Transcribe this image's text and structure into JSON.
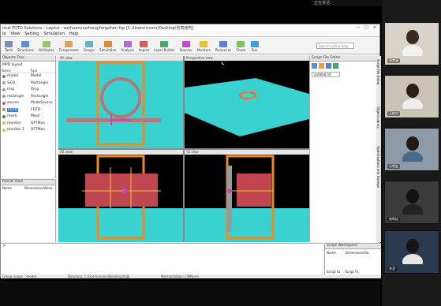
{
  "window": {
    "title": "rical FDTD Solutions - Layout - weihuanxiuzhong/fangzhen.fsp [C:/Users/vivers/Desktop/仿真结构]",
    "controls": [
      "—",
      "□",
      "✕"
    ]
  },
  "menu": [
    "le",
    "View",
    "Setting",
    "Simulation",
    "Help"
  ],
  "toolbar": {
    "items": [
      "Tools",
      "Structures",
      "Attributes",
      "Components",
      "Groups",
      "Simulation",
      "Analysis",
      "Import",
      "Layer Builder",
      "Sources",
      "Monitors",
      "Resources",
      "Check",
      "Run"
    ],
    "search_placeholder": "Search online help"
  },
  "object_tree": {
    "title": "Objects Tree",
    "group": "MPD layout",
    "columns": [
      "Name",
      "Type"
    ],
    "rows": [
      {
        "name": "model",
        "type": "Model",
        "color": "#5a7fb5"
      },
      {
        "name": "SiO2",
        "type": "Rectangle",
        "color": "#9a9a9a"
      },
      {
        "name": "ring",
        "type": "Ring",
        "color": "#9a9a9a"
      },
      {
        "name": "rectangle",
        "type": "Rectangle",
        "color": "#9a9a9a"
      },
      {
        "name": "source",
        "type": "ModeSource",
        "color": "#c24ac2"
      },
      {
        "name": "FDTD",
        "type": "FDTD",
        "color": "#d9822b",
        "selected": true
      },
      {
        "name": "mesh",
        "type": "Mesh",
        "color": "#6b6b6b"
      },
      {
        "name": "monitor",
        "type": "DFTMon",
        "color": "#e6c42b"
      },
      {
        "name": "monitor 1",
        "type": "DFTMon",
        "color": "#e6c42b"
      }
    ]
  },
  "script_vars": {
    "title": "Result View",
    "columns": [
      "Name",
      "Dimensions/Value"
    ]
  },
  "views": {
    "xy": "XY view",
    "perspective": "Perspective view",
    "xz": "XZ view",
    "yz": "YZ view"
  },
  "script_editor": {
    "title": "Script File Editor",
    "tab": "untitled.lsf"
  },
  "vertical_tabs": [
    "Script File Editor",
    "Object Library",
    "Optimizations and Sweeps"
  ],
  "command": {
    "prompt": ">"
  },
  "workspace": {
    "title": "Script Workspace",
    "columns": [
      "Name",
      "Dimensions/Va"
    ],
    "tabs": [
      "Script Fa",
      "Script Fa"
    ]
  },
  "status": {
    "left": "Group scope: ::model",
    "directory": "Directory: C:/Users/vivers/Desktop/仿真",
    "normalization": "Normalization: CWNorm"
  },
  "overlay_caption": "正在讲话：",
  "participants": [
    {
      "name": "郭梦涵"
    },
    {
      "name": "王梓宁"
    },
    {
      "name": "小朋友"
    },
    {
      "name": "张鸣远"
    },
    {
      "name": "李凌"
    }
  ],
  "colors": {
    "cyan": "#3ad1d1",
    "orange": "#f08a1a",
    "ring": "#b07a7a",
    "block": "#c0474f",
    "accent_selected": "#3b7bd9"
  }
}
